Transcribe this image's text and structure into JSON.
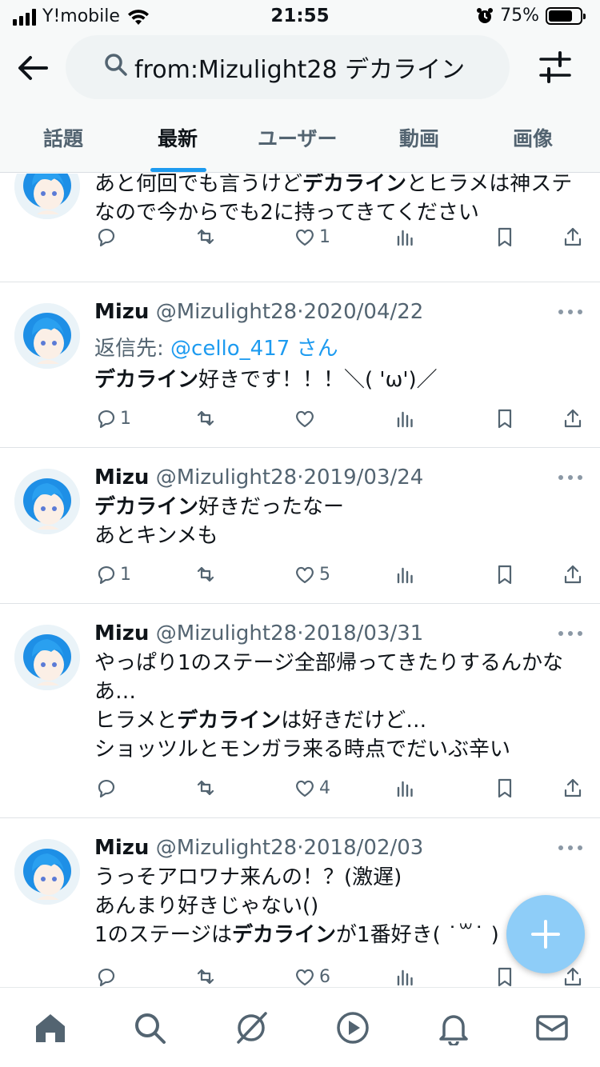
{
  "status_bar": {
    "carrier": "Y!mobile",
    "time": "21:55",
    "battery_percent": "75%",
    "battery_level": 0.75
  },
  "search": {
    "query": "from:Mizulight28 デカライン"
  },
  "tabs": [
    {
      "label": "話題",
      "active": false
    },
    {
      "label": "最新",
      "active": true
    },
    {
      "label": "ユーザー",
      "active": false
    },
    {
      "label": "動画",
      "active": false
    },
    {
      "label": "画像",
      "active": false
    }
  ],
  "tweets": [
    {
      "name": "",
      "handle": "",
      "date": "",
      "body_html": "あと何回でも言うけど<b>デカライン</b>とヒラメは神ステ<br>なので今からでも2に持ってきてください",
      "replies": "",
      "likes": "1"
    },
    {
      "name": "Mizu",
      "handle": "@Mizulight28",
      "date": "2020/04/22",
      "reply_prefix": "返信先: ",
      "reply_mention": "@cello_417",
      "reply_suffix": " さん",
      "body_html": "<b>デカライン</b>好きです！！！＼( 'ω')／",
      "replies": "1",
      "likes": ""
    },
    {
      "name": "Mizu",
      "handle": "@Mizulight28",
      "date": "2019/03/24",
      "body_html": "<b>デカライン</b>好きだったなー<br>あとキンメも",
      "replies": "1",
      "likes": "5"
    },
    {
      "name": "Mizu",
      "handle": "@Mizulight28",
      "date": "2018/03/31",
      "body_html": "やっぱり1のステージ全部帰ってきたりするんかな<br>あ…<br>ヒラメと<b>デカライン</b>は好きだけど…<br>ショッツルとモンガラ来る時点でだいぶ辛い",
      "replies": "",
      "likes": "4"
    },
    {
      "name": "Mizu",
      "handle": "@Mizulight28",
      "date": "2018/02/03",
      "body_html": "うっそアロワナ来んの！？(激遅)<br>あんまり好きじゃない()<br>1のステージは<b>デカライン</b>が1番好き( ˙꒳˙ )",
      "replies": "",
      "likes": "6"
    }
  ],
  "colors": {
    "accent": "#1d9bf0",
    "text": "#0f1419",
    "muted": "#536471",
    "fab": "#8ecdf8"
  },
  "bottom_nav": [
    "home-icon",
    "search-icon",
    "spaces-icon",
    "video-icon",
    "notifications-icon",
    "messages-icon"
  ]
}
